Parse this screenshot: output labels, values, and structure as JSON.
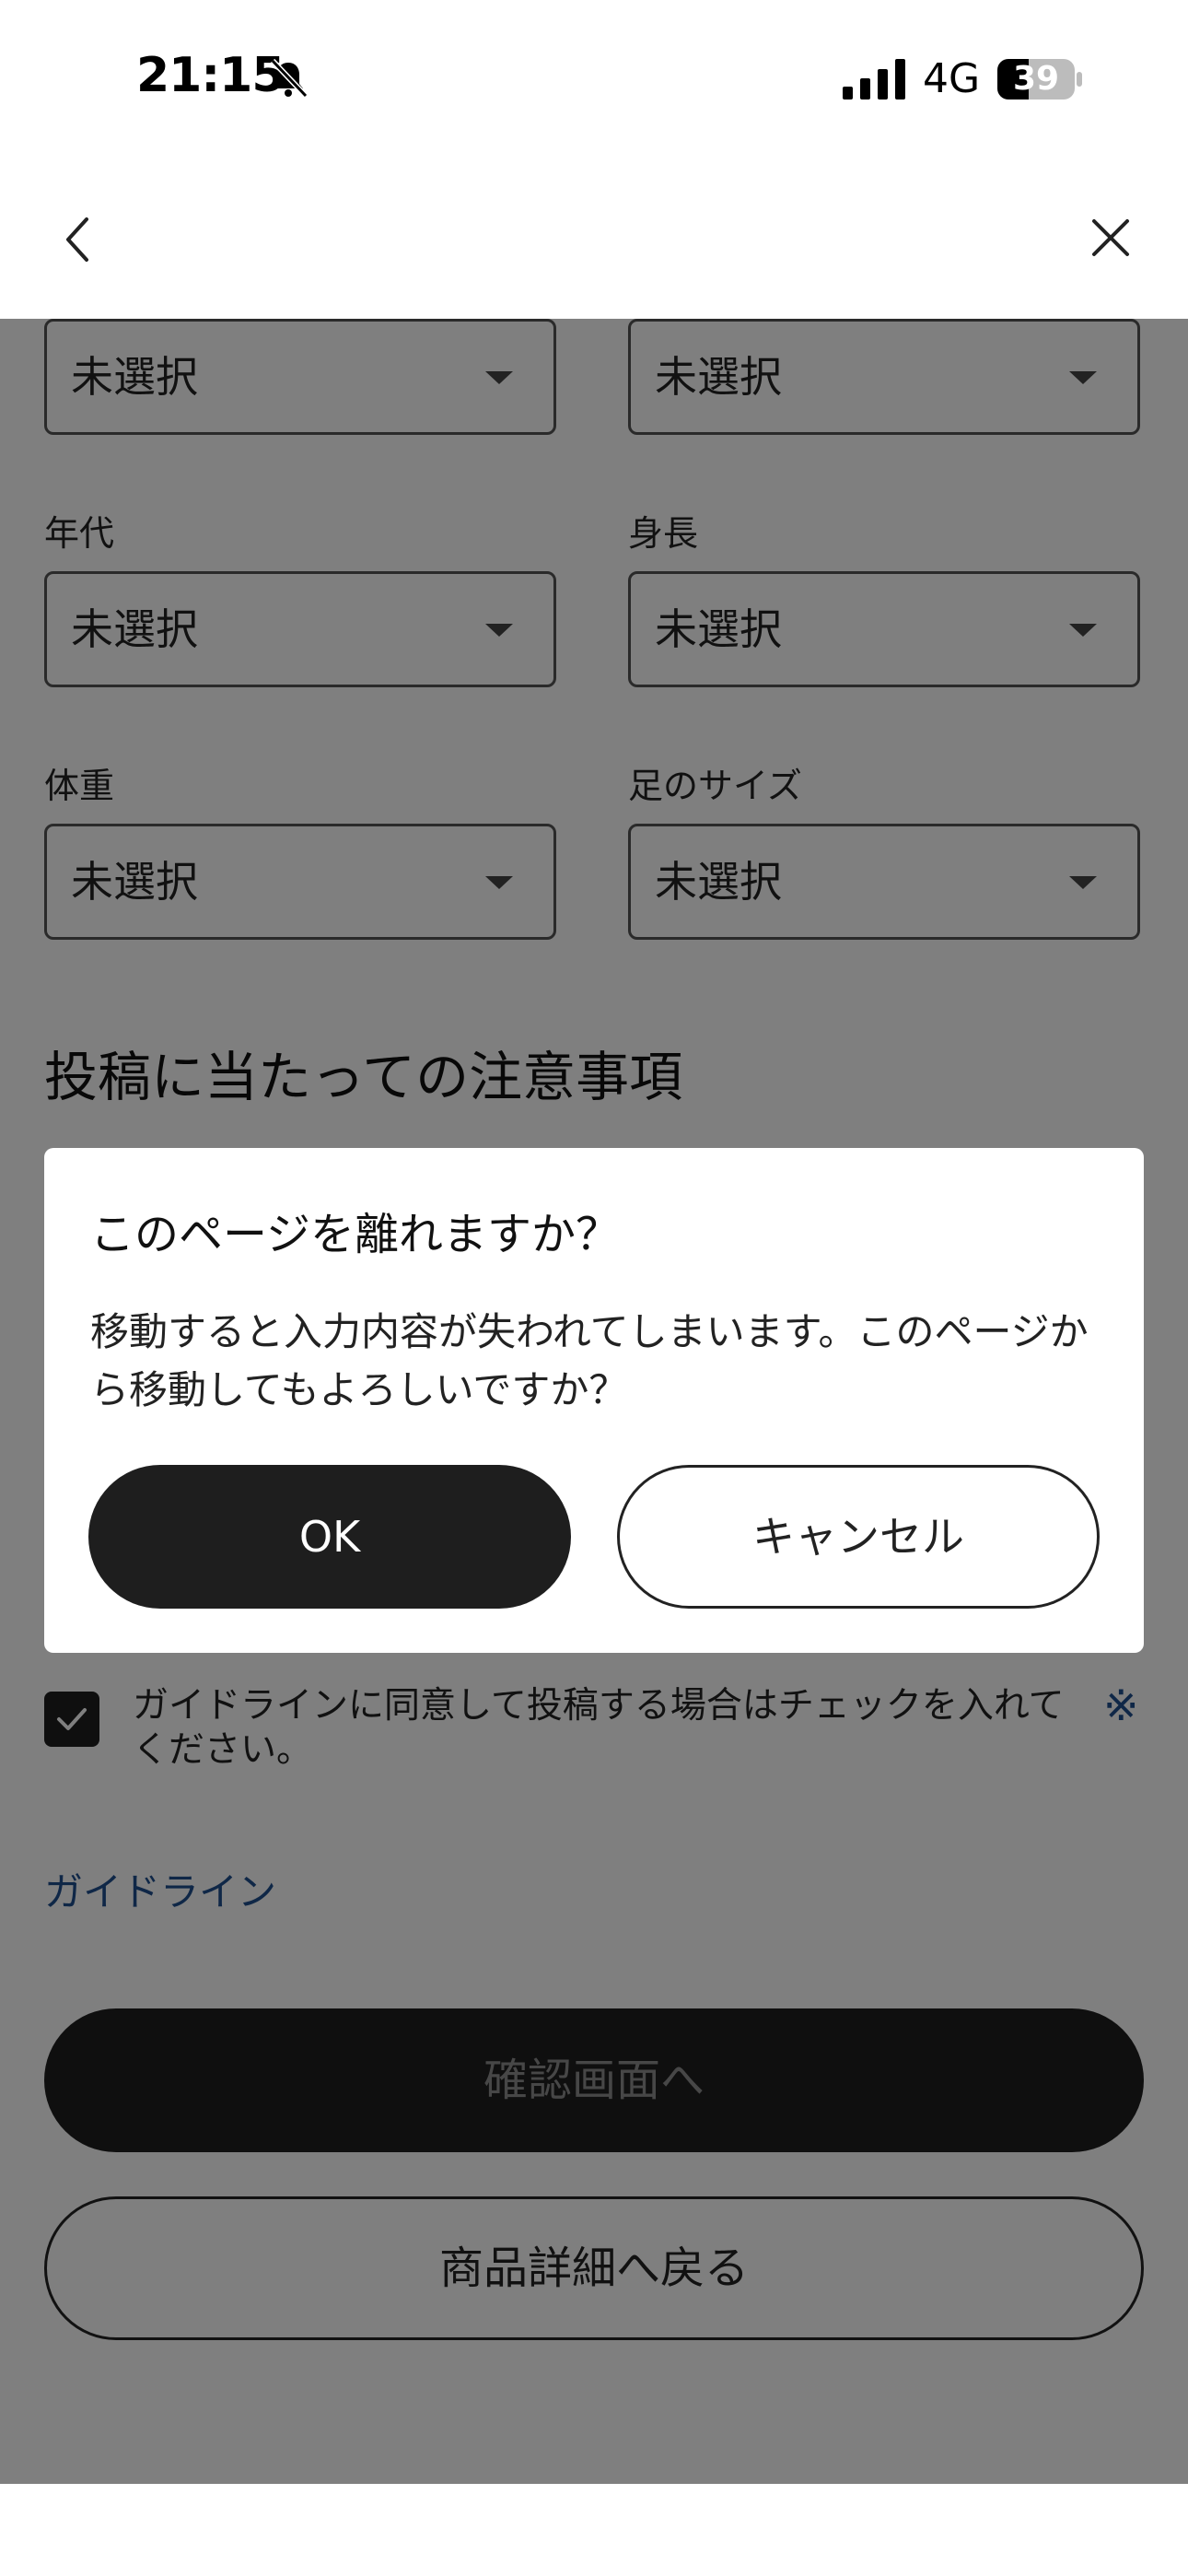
{
  "status_bar": {
    "time": "21:15",
    "network": "4G",
    "battery": "39",
    "icons": [
      "bell-slash-icon",
      "signal-icon",
      "battery-icon"
    ]
  },
  "nav": {
    "back_icon": "chevron-left-icon",
    "close_icon": "close-icon"
  },
  "form": {
    "fields": [
      {
        "label": "",
        "value": "未選択"
      },
      {
        "label": "",
        "value": "未選択"
      },
      {
        "label": "年代",
        "value": "未選択"
      },
      {
        "label": "身長",
        "value": "未選択"
      },
      {
        "label": "体重",
        "value": "未選択"
      },
      {
        "label": "足のサイズ",
        "value": "未選択"
      }
    ],
    "section_title": "投稿に当たっての注意事項",
    "guideline_check_text": "ガイドラインに同意して投稿する場合はチェックを入れてください。",
    "guideline_checked": true,
    "required_mark": "※",
    "guideline_link": "ガイドライン",
    "confirm_button": "確認画面へ",
    "back_button": "商品詳細へ戻る"
  },
  "dialog": {
    "title": "このページを離れますか？",
    "message": "移動すると入力内容が失われてしまいます。このページから移動してもよろしいですか？",
    "ok_label": "OK",
    "cancel_label": "キャンセル"
  },
  "colors": {
    "accent_link": "#1f4f8f",
    "primary_button": "#1e1e1e",
    "overlay": "rgba(0,0,0,0.5)"
  }
}
